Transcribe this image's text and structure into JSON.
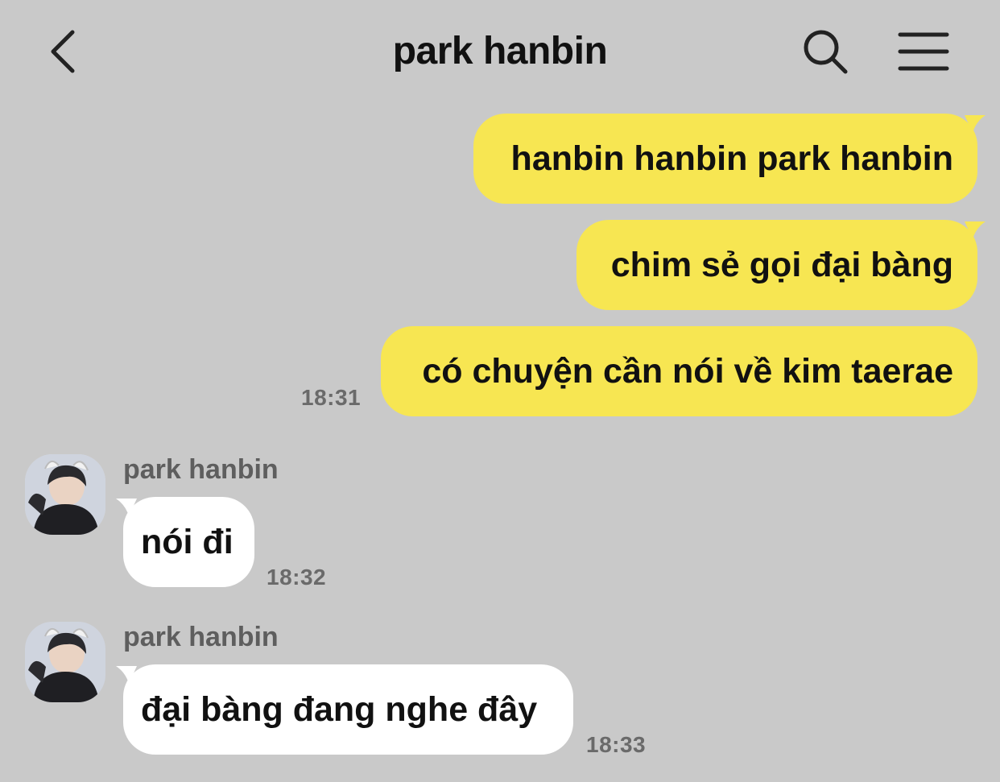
{
  "header": {
    "title": "park hanbin",
    "back_icon": "chevron-left-icon",
    "search_icon": "search-icon",
    "menu_icon": "hamburger-menu-icon"
  },
  "colors": {
    "background": "#c9c9c9",
    "my_bubble": "#f7e652",
    "their_bubble": "#ffffff",
    "time_text": "#6a6a6a"
  },
  "messages": {
    "m1": {
      "text": "hanbin hanbin park hanbin"
    },
    "m2": {
      "text": "chim sẻ gọi đại bàng"
    },
    "m3": {
      "text": "có chuyện cần nói về kim taerae",
      "time": "18:31"
    },
    "m4": {
      "sender": "park hanbin",
      "text": "nói đi",
      "time": "18:32"
    },
    "m5": {
      "sender": "park hanbin",
      "text": "đại bàng đang nghe đây",
      "time": "18:33"
    }
  }
}
